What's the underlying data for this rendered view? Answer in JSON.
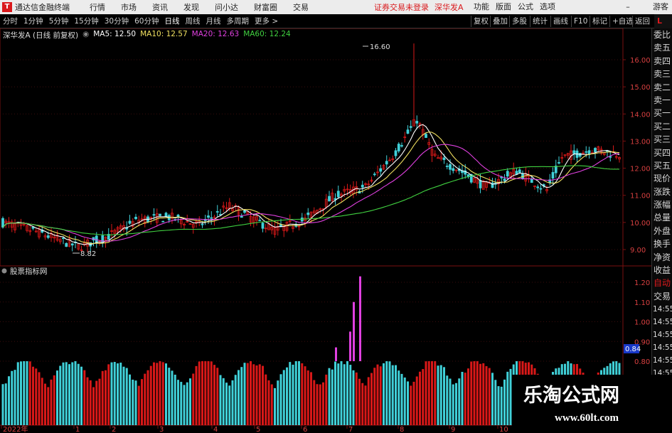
{
  "topbar": {
    "app_title": "通达信金融终端",
    "menus": [
      "行情",
      "市场",
      "资讯",
      "发现",
      "问小达",
      "财富圈",
      "交易"
    ],
    "account_warning": "证券交易未登录",
    "stock_name": "深华发A",
    "right_menus": [
      "功能",
      "版面",
      "公式",
      "选项"
    ],
    "minimize": "–",
    "guest": "游客"
  },
  "periodbar": {
    "periods": [
      "分时",
      "1分钟",
      "5分钟",
      "15分钟",
      "30分钟",
      "60分钟",
      "日线",
      "周线",
      "月线",
      "多周期",
      "更多 >"
    ],
    "active": "日线",
    "tools": [
      "复权",
      "叠加",
      "多股",
      "统计",
      "画线",
      "F10",
      "标记",
      "+自选",
      "返回"
    ],
    "right_tag": "L"
  },
  "chart_info": {
    "title": "深华发A (日线 前复权)",
    "ma": [
      {
        "label": "MA5: 12.50",
        "color": "#ffffff"
      },
      {
        "label": "MA10: 12.57",
        "color": "#f0e060"
      },
      {
        "label": "MA20: 12.63",
        "color": "#e040e0"
      },
      {
        "label": "MA60: 12.24",
        "color": "#40d040"
      }
    ],
    "high_label": "16.60",
    "low_label": "8.82"
  },
  "price_axis": [
    "16.00",
    "15.00",
    "14.00",
    "13.00",
    "12.00",
    "11.00",
    "10.00",
    "9.00"
  ],
  "indicator": {
    "title": "股票指标网",
    "axis": [
      "1.20",
      "1.10",
      "1.00",
      "0.90",
      "0.80"
    ],
    "current": "0.84"
  },
  "date_axis": [
    "2022年",
    "1",
    "2",
    "3",
    "4",
    "5",
    "6",
    "7",
    "8",
    "9",
    "10"
  ],
  "sidepanel": {
    "items": [
      "委比",
      "卖五",
      "卖四",
      "卖三",
      "卖二",
      "卖一",
      "买一",
      "买二",
      "买三",
      "买四",
      "买五",
      "现价",
      "涨跌",
      "涨幅",
      "总量",
      "外盘",
      "换手",
      "净资",
      "收益"
    ],
    "auto": [
      "自动",
      "交易"
    ],
    "times": [
      "14:55",
      "14:55",
      "14:55",
      "14:55",
      "14:55",
      "14:55",
      "14:55",
      "14:56",
      "14:56"
    ]
  },
  "watermark": {
    "title": "乐淘公式网",
    "url": "www.60lt.com"
  },
  "colors": {
    "up": "#d81818",
    "down": "#40d0d8",
    "ma5": "#ffffff",
    "ma10": "#f0e060",
    "ma20": "#e040e0",
    "ma60": "#40d040",
    "brand_red": "#d9191c",
    "bars_magenta": "#e040e0"
  }
}
